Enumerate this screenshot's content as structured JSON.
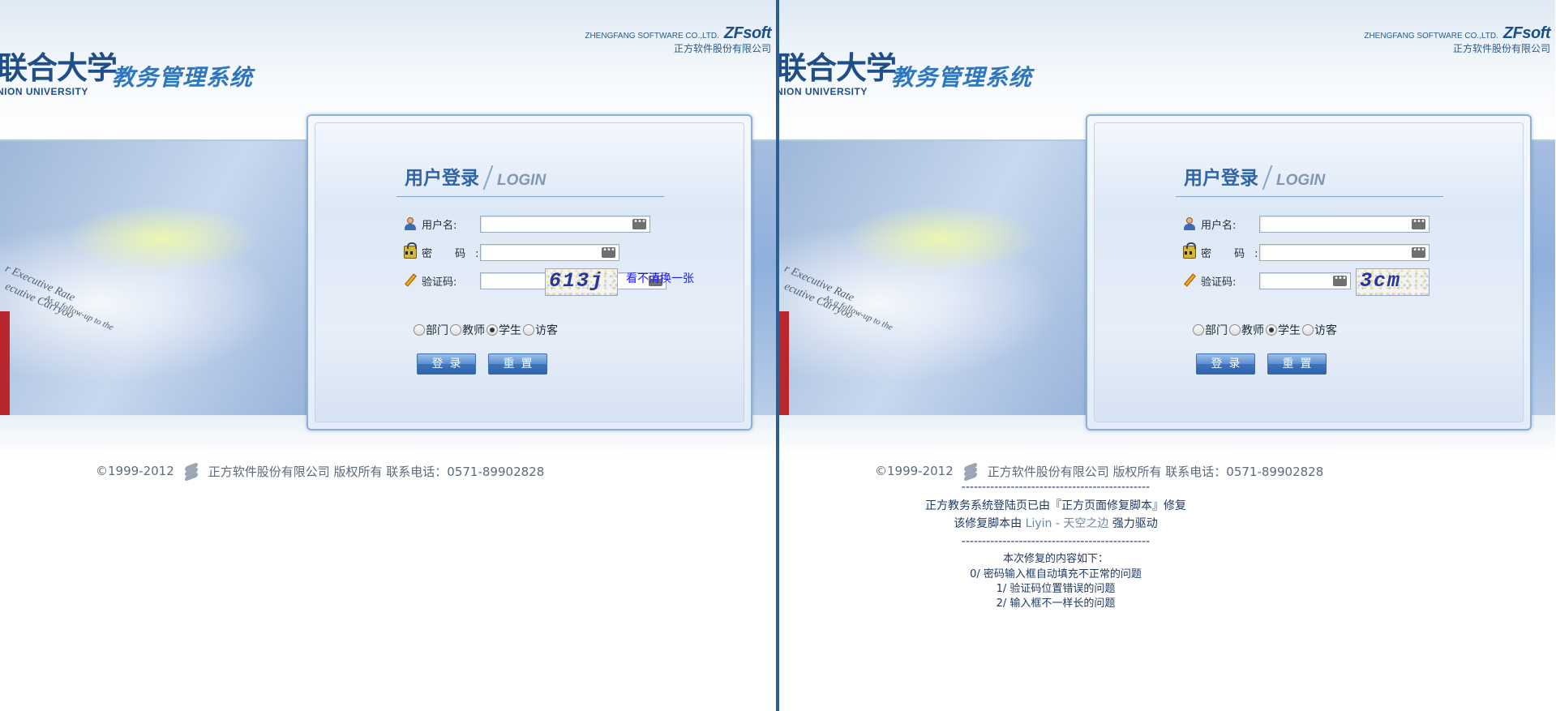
{
  "left": {
    "university_cn": "联合大学",
    "university_en": "NION UNIVERSITY",
    "system_title": "教务管理系统",
    "vendor_en": "ZHENGFANG SOFTWARE CO.,LTD.",
    "vendor_brand": "ZFsoft",
    "vendor_cn": "正方软件股份有限公司",
    "banner_text": [
      "r Executive Rate",
      "ecutive Carryoo",
      "As a follow-up to the"
    ],
    "login_title_cn": "用户登录",
    "login_title_en": "LOGIN",
    "username_label": "用户名:",
    "password_label": "密 码:",
    "captcha_label": "验证码:",
    "username_value": "",
    "password_value": "",
    "captcha_value": "",
    "dots": "•••",
    "captcha_text": "613j",
    "captcha_link": "看不清换一张",
    "roles": [
      "部门",
      "教师",
      "学生",
      "访客"
    ],
    "selected_role": "学生",
    "login_button": "登录",
    "reset_button": "重置",
    "footer_copyright": "©1999-2012",
    "footer_company": "正方软件股份有限公司 版权所有  联系电话：0571-89902828"
  },
  "right": {
    "university_cn": "联合大学",
    "university_en": "NION UNIVERSITY",
    "system_title": "教务管理系统",
    "vendor_en": "ZHENGFANG SOFTWARE CO.,LTD.",
    "vendor_brand": "ZFsoft",
    "vendor_cn": "正方软件股份有限公司",
    "banner_text": [
      "r Executive Rate",
      "ecutive Carryoo",
      "As a follow-up to the"
    ],
    "login_title_cn": "用户登录",
    "login_title_en": "LOGIN",
    "username_label": "用户名:",
    "password_label": "密 码:",
    "captcha_label": "验证码:",
    "username_value": "",
    "password_value": "",
    "captcha_value": "",
    "dots": "•••",
    "captcha_text": "3cm",
    "roles": [
      "部门",
      "教师",
      "学生",
      "访客"
    ],
    "selected_role": "学生",
    "login_button": "登录",
    "reset_button": "重置",
    "footer_copyright": "©1999-2012",
    "footer_company": "正方软件股份有限公司 版权所有  联系电话：0571-89902828",
    "separator": "----------------------------------------------",
    "note_fixed_prefix": "正方教务系统登陆页已由『正方页面修复脚本』修复",
    "note_author_prefix": "该修复脚本由",
    "note_author": "Liyin - 天空之边",
    "note_author_suffix": "强力驱动",
    "note_fix_intro": "本次修复的内容如下：",
    "fixes": [
      "0/ 密码输入框自动填充不正常的问题",
      "1/ 验证码位置错误的问题",
      "2/ 输入框不一样长的问题"
    ]
  },
  "colors": {
    "divider": "#2c5f8f",
    "title_blue": "#2d76c0",
    "login_blue": "#2f64a6",
    "link": "#1a1aff",
    "button": "#3f74ba"
  }
}
